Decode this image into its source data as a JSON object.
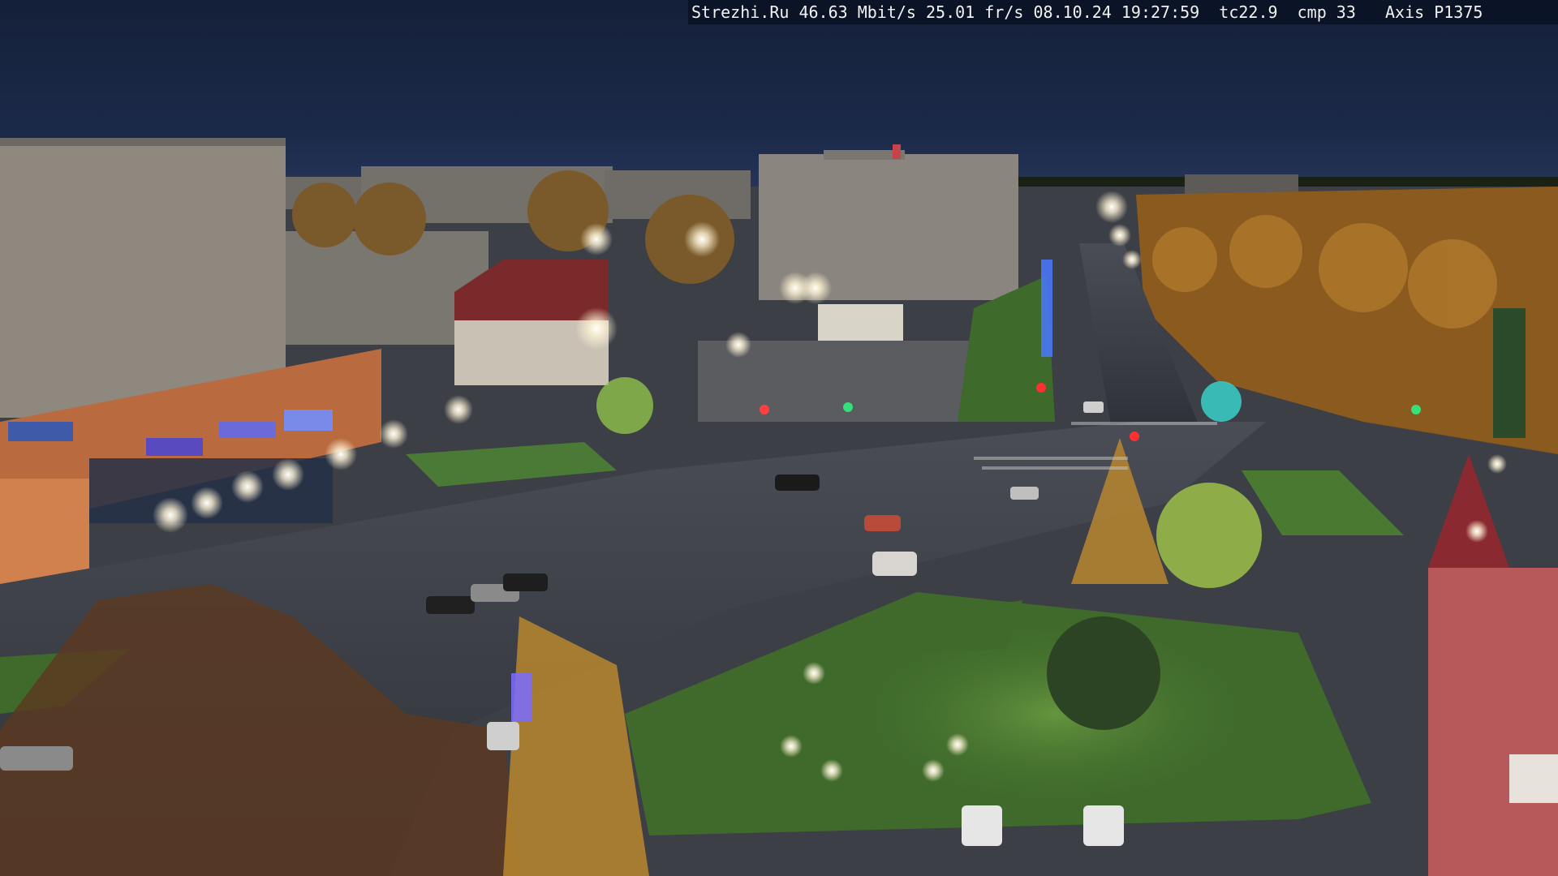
{
  "camera": {
    "site": "Strezhi.Ru",
    "bitrate": "46.63 Mbit/s",
    "framerate": "25.01 fr/s",
    "date": "08.10.24",
    "time": "19:27:59",
    "tc": "tc22.9",
    "cmp": "cmp 33",
    "model": "Axis P1375"
  },
  "scene": {
    "time_of_day": "dusk",
    "sky_color": "#1c2a4a",
    "road_color": "#3a3d44",
    "grass_color": "#3f6a2c",
    "foliage_color": "#a8712a",
    "street_light_color": "#fff4d6"
  }
}
